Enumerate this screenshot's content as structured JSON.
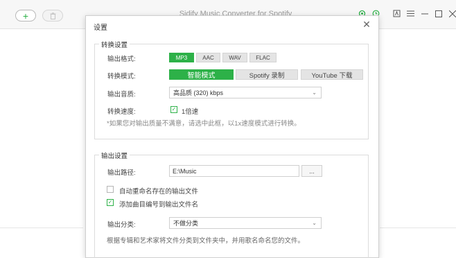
{
  "app": {
    "title": "Sidify Music Converter for Spotify",
    "colors": {
      "accent": "#2db148"
    }
  },
  "dialog": {
    "title": "设置",
    "close_glyph": "✕",
    "convert_settings": {
      "group_title": "转换设置",
      "format_label": "输出格式:",
      "formats": [
        "MP3",
        "AAC",
        "WAV",
        "FLAC"
      ],
      "selected_format": "MP3",
      "mode_label": "转换模式:",
      "modes": [
        "智能模式",
        "Spotify 录制",
        "YouTube 下载"
      ],
      "selected_mode": "智能模式",
      "quality_label": "输出音质:",
      "quality_value": "高品质 (320) kbps",
      "speed_label": "转换速度:",
      "speed_option": "1倍速",
      "speed_checked": true,
      "hint": "*如果您对输出质量不满意，请选中此框，以1x速度模式进行转换。"
    },
    "output_settings": {
      "group_title": "输出设置",
      "path_label": "输出路径:",
      "path_value": "E:\\Music",
      "browse_label": "...",
      "auto_rename_label": "自动重命名存在的输出文件",
      "auto_rename_checked": false,
      "add_track_number_label": "添加曲目编号到输出文件名",
      "add_track_number_checked": true,
      "classify_label": "输出分类:",
      "classify_value": "不做分类",
      "classify_hint": "根据专辑和艺术家将文件分类到文件夹中，并用歌名命名您的文件。"
    }
  }
}
